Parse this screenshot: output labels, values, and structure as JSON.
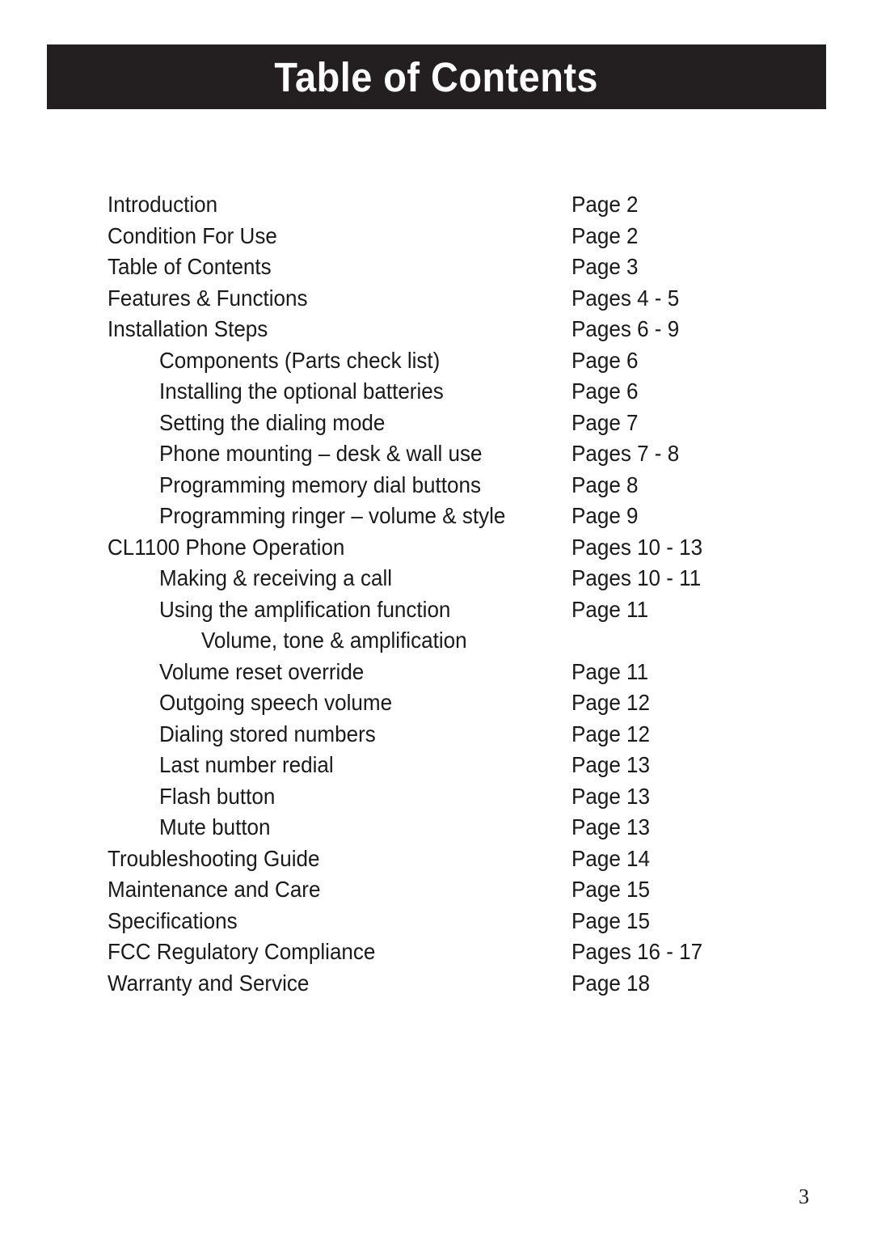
{
  "document": {
    "header": {
      "title": "Table of Contents",
      "background_color": "#231f20",
      "text_color": "#ffffff"
    },
    "footer": {
      "page_number": "3"
    },
    "toc": {
      "entries": [
        {
          "label": "Introduction",
          "page": "Page 2",
          "level": 0
        },
        {
          "label": "Condition For Use",
          "page": "Page 2",
          "level": 0
        },
        {
          "label": "Table of Contents",
          "page": "Page 3",
          "level": 0
        },
        {
          "label": "Features & Functions",
          "page": "Pages 4 - 5",
          "level": 0
        },
        {
          "label": "Installation Steps",
          "page": "Pages 6 - 9",
          "level": 0
        },
        {
          "label": "Components (Parts check list)",
          "page": "Page 6",
          "level": 1
        },
        {
          "label": "Installing the optional batteries",
          "page": "Page 6",
          "level": 1
        },
        {
          "label": "Setting the dialing mode",
          "page": "Page 7",
          "level": 1
        },
        {
          "label": "Phone mounting – desk & wall use",
          "page": "Pages 7 - 8",
          "level": 1
        },
        {
          "label": "Programming memory dial buttons",
          "page": "Page 8",
          "level": 1
        },
        {
          "label": "Programming ringer – volume & style",
          "page": "Page 9",
          "level": 1
        },
        {
          "label": "CL1100 Phone Operation",
          "page": "Pages 10 - 13",
          "level": 0
        },
        {
          "label": "Making & receiving a call",
          "page": "Pages 10 - 11",
          "level": 1
        },
        {
          "label": "Using the amplification function",
          "page": "Page 11",
          "level": 1
        },
        {
          "label": "Volume, tone & amplification",
          "page": "",
          "level": 2
        },
        {
          "label": "Volume reset override",
          "page": "Page 11",
          "level": 1
        },
        {
          "label": "Outgoing speech volume",
          "page": "Page 12",
          "level": 1
        },
        {
          "label": "Dialing stored numbers",
          "page": "Page 12",
          "level": 1
        },
        {
          "label": "Last number redial",
          "page": "Page 13",
          "level": 1
        },
        {
          "label": "Flash button",
          "page": "Page 13",
          "level": 1
        },
        {
          "label": "Mute button",
          "page": "Page 13",
          "level": 1
        },
        {
          "label": "Troubleshooting Guide",
          "page": "Page 14",
          "level": 0
        },
        {
          "label": "Maintenance and Care",
          "page": "Page 15",
          "level": 0
        },
        {
          "label": "Specifications",
          "page": "Page 15",
          "level": 0
        },
        {
          "label": "FCC Regulatory Compliance",
          "page": "Pages 16 - 17",
          "level": 0
        },
        {
          "label": "Warranty and Service",
          "page": "Page 18",
          "level": 0
        }
      ]
    }
  }
}
